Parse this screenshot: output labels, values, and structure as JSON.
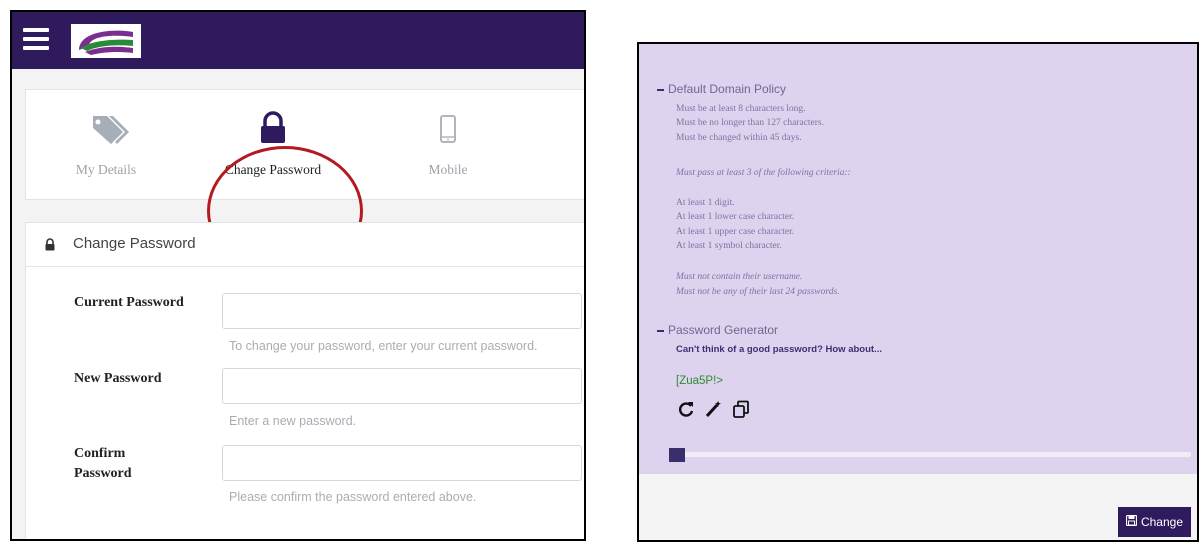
{
  "left": {
    "tabs": [
      {
        "label": "My Details",
        "icon": "tags-icon"
      },
      {
        "label": "Change Password",
        "icon": "lock-icon"
      },
      {
        "label": "Mobile",
        "icon": "mobile-icon"
      }
    ],
    "panel_title": "Change Password",
    "fields": [
      {
        "label": "Current Password",
        "value": "",
        "help": "To change your password, enter your current password."
      },
      {
        "label": "New Password",
        "value": "",
        "help": "Enter a new password."
      },
      {
        "label": "Confirm Password",
        "value": "",
        "help": "Please confirm the password entered above."
      }
    ],
    "colors": {
      "header": "#2f1a5e",
      "highlight": "#b31b20"
    }
  },
  "right": {
    "policy_title": "Default Domain Policy",
    "rules": [
      "Must be at least 8 characters long.",
      "Must be no longer than 127 characters.",
      "Must be changed within 45 days."
    ],
    "criteria_intro": "Must pass at least 3 of the following criteria::",
    "criteria": [
      "At least 1 digit.",
      "At least 1 lower case character.",
      "At least 1 upper case character.",
      "At least 1 symbol character."
    ],
    "restrictions": [
      "Must not contain their username.",
      "Must not be any of their last 24 passwords."
    ],
    "generator_title": "Password Generator",
    "generator_question": "Can't think of a good password? How about...",
    "generated_password": "[Zua5P!>",
    "strength": 0.03,
    "button_label": "Change",
    "colors": {
      "background": "#ddd3ef",
      "password": "#2f8a2f"
    }
  }
}
